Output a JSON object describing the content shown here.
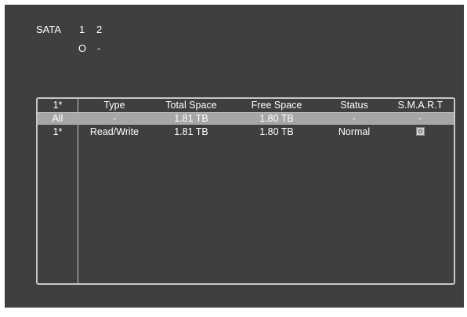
{
  "sata": {
    "label": "SATA",
    "ports": [
      "1",
      "2"
    ],
    "port_status": [
      "O",
      "-"
    ]
  },
  "table": {
    "headers": [
      "1*",
      "Type",
      "Total Space",
      "Free Space",
      "Status",
      "S.M.A.R.T"
    ],
    "rows": [
      {
        "id": "All",
        "type": "-",
        "total": "1.81 TB",
        "free": "1.80 TB",
        "status": "-",
        "smart": "-"
      },
      {
        "id": "1*",
        "type": "Read/Write",
        "total": "1.81 TB",
        "free": "1.80 TB",
        "status": "Normal",
        "smart_icon": "smart-info-icon"
      }
    ]
  }
}
